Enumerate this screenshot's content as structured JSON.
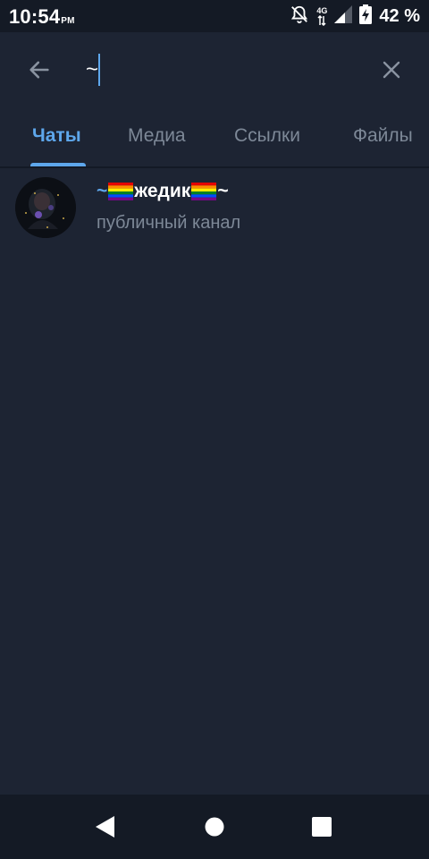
{
  "status_bar": {
    "time": "10:54",
    "ampm": "PM",
    "network_label": "4G",
    "battery": "42 %",
    "icons": [
      "notifications-off-icon",
      "data-arrows-icon",
      "signal-icon",
      "battery-charging-icon"
    ]
  },
  "search": {
    "value": "~",
    "back_icon": "arrow-left-icon",
    "clear_icon": "close-icon"
  },
  "tabs": [
    {
      "label": "Чаты",
      "active": true
    },
    {
      "label": "Медиа",
      "active": false
    },
    {
      "label": "Ссылки",
      "active": false
    },
    {
      "label": "Файлы",
      "active": false
    }
  ],
  "results": [
    {
      "title_prefix": "~",
      "title_main": "жедик",
      "title_suffix": "~",
      "title_emoji": "rainbow-flag",
      "subtitle": "публичный канал"
    }
  ],
  "nav_bar": {
    "icons": [
      "back-triangle-icon",
      "home-circle-icon",
      "recents-square-icon"
    ]
  },
  "colors": {
    "background": "#1d2433",
    "status_bar": "#141a25",
    "accent": "#5ea7ec",
    "muted_text": "#7d8897",
    "text": "#ffffff"
  }
}
